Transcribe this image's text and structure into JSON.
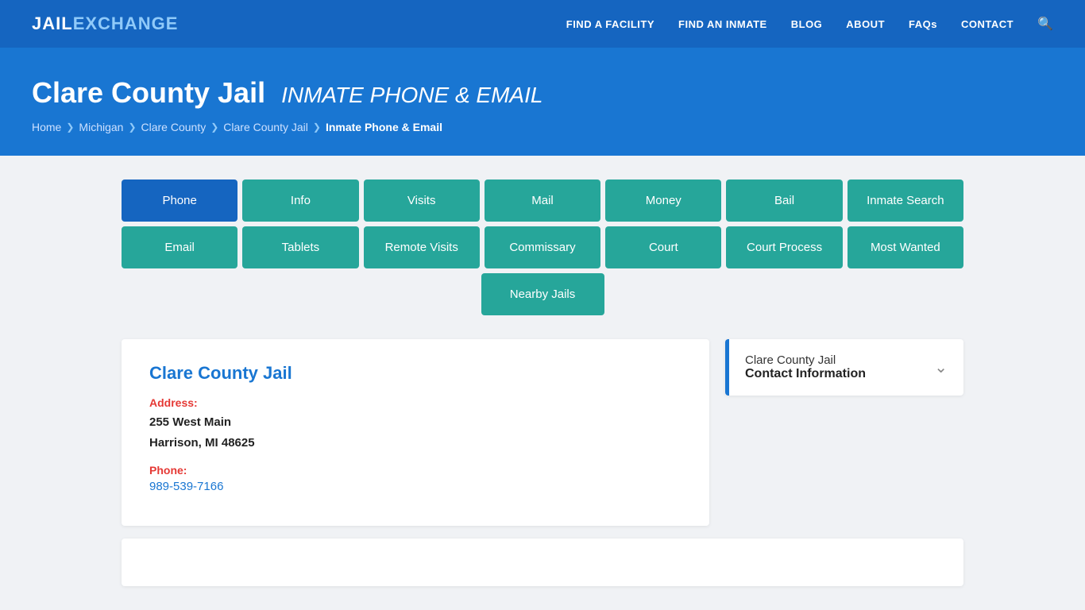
{
  "header": {
    "logo_jail": "JAIL",
    "logo_exchange": "EXCHANGE",
    "nav": [
      {
        "label": "FIND A FACILITY",
        "id": "find-facility"
      },
      {
        "label": "FIND AN INMATE",
        "id": "find-inmate"
      },
      {
        "label": "BLOG",
        "id": "blog"
      },
      {
        "label": "ABOUT",
        "id": "about"
      },
      {
        "label": "FAQs",
        "id": "faqs"
      },
      {
        "label": "CONTACT",
        "id": "contact"
      }
    ]
  },
  "hero": {
    "title_main": "Clare County Jail",
    "title_sub": "INMATE PHONE & EMAIL",
    "breadcrumb": [
      {
        "label": "Home",
        "id": "bc-home"
      },
      {
        "label": "Michigan",
        "id": "bc-michigan"
      },
      {
        "label": "Clare County",
        "id": "bc-county"
      },
      {
        "label": "Clare County Jail",
        "id": "bc-jail"
      },
      {
        "label": "Inmate Phone & Email",
        "id": "bc-current",
        "current": true
      }
    ]
  },
  "tabs_row1": [
    {
      "label": "Phone",
      "active": true,
      "id": "tab-phone"
    },
    {
      "label": "Info",
      "active": false,
      "id": "tab-info"
    },
    {
      "label": "Visits",
      "active": false,
      "id": "tab-visits"
    },
    {
      "label": "Mail",
      "active": false,
      "id": "tab-mail"
    },
    {
      "label": "Money",
      "active": false,
      "id": "tab-money"
    },
    {
      "label": "Bail",
      "active": false,
      "id": "tab-bail"
    },
    {
      "label": "Inmate Search",
      "active": false,
      "id": "tab-inmate-search"
    }
  ],
  "tabs_row2": [
    {
      "label": "Email",
      "active": false,
      "id": "tab-email"
    },
    {
      "label": "Tablets",
      "active": false,
      "id": "tab-tablets"
    },
    {
      "label": "Remote Visits",
      "active": false,
      "id": "tab-remote-visits"
    },
    {
      "label": "Commissary",
      "active": false,
      "id": "tab-commissary"
    },
    {
      "label": "Court",
      "active": false,
      "id": "tab-court"
    },
    {
      "label": "Court Process",
      "active": false,
      "id": "tab-court-process"
    },
    {
      "label": "Most Wanted",
      "active": false,
      "id": "tab-most-wanted"
    }
  ],
  "tabs_row3": [
    {
      "label": "Nearby Jails",
      "active": false,
      "id": "tab-nearby-jails"
    }
  ],
  "info_card": {
    "title": "Clare County Jail",
    "address_label": "Address:",
    "address_line1": "255 West Main",
    "address_line2": "Harrison, MI 48625",
    "phone_label": "Phone:",
    "phone_number": "989-539-7166"
  },
  "sidebar": {
    "title_top": "Clare County Jail",
    "title_bottom": "Contact Information"
  }
}
